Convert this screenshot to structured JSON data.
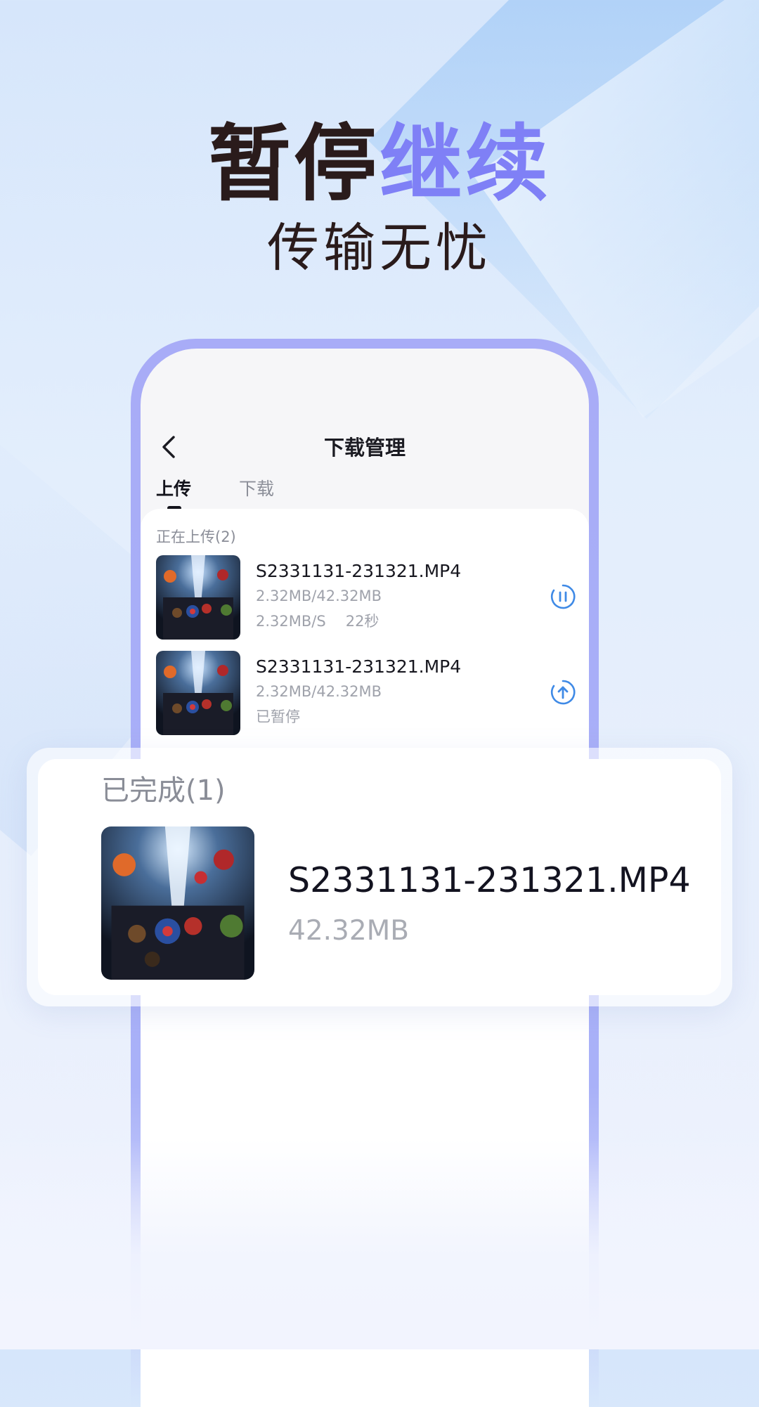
{
  "promo": {
    "headline_dark": "暂停",
    "headline_accent": "继续",
    "subheadline": "传输无忧",
    "accent_color": "#7f80f6"
  },
  "app": {
    "title": "下载管理",
    "back_icon": "chevron-left-icon",
    "tabs": [
      {
        "label": "上传",
        "active": true
      },
      {
        "label": "下载",
        "active": false
      }
    ]
  },
  "uploading": {
    "section_label": "正在上传(2)",
    "items": [
      {
        "name": "S2331131-231321.MP4",
        "progress": "2.32MB/42.32MB",
        "speed": "2.32MB/S",
        "remaining": "22秒",
        "action_icon": "pause-icon"
      },
      {
        "name": "S2331131-231321.MP4",
        "progress": "2.32MB/42.32MB",
        "status": "已暂停",
        "action_icon": "upload-icon"
      }
    ]
  },
  "completed": {
    "section_label": "已完成(1)",
    "items": [
      {
        "name": "S2331131-231321.MP4",
        "size": "42.32MB"
      }
    ]
  }
}
